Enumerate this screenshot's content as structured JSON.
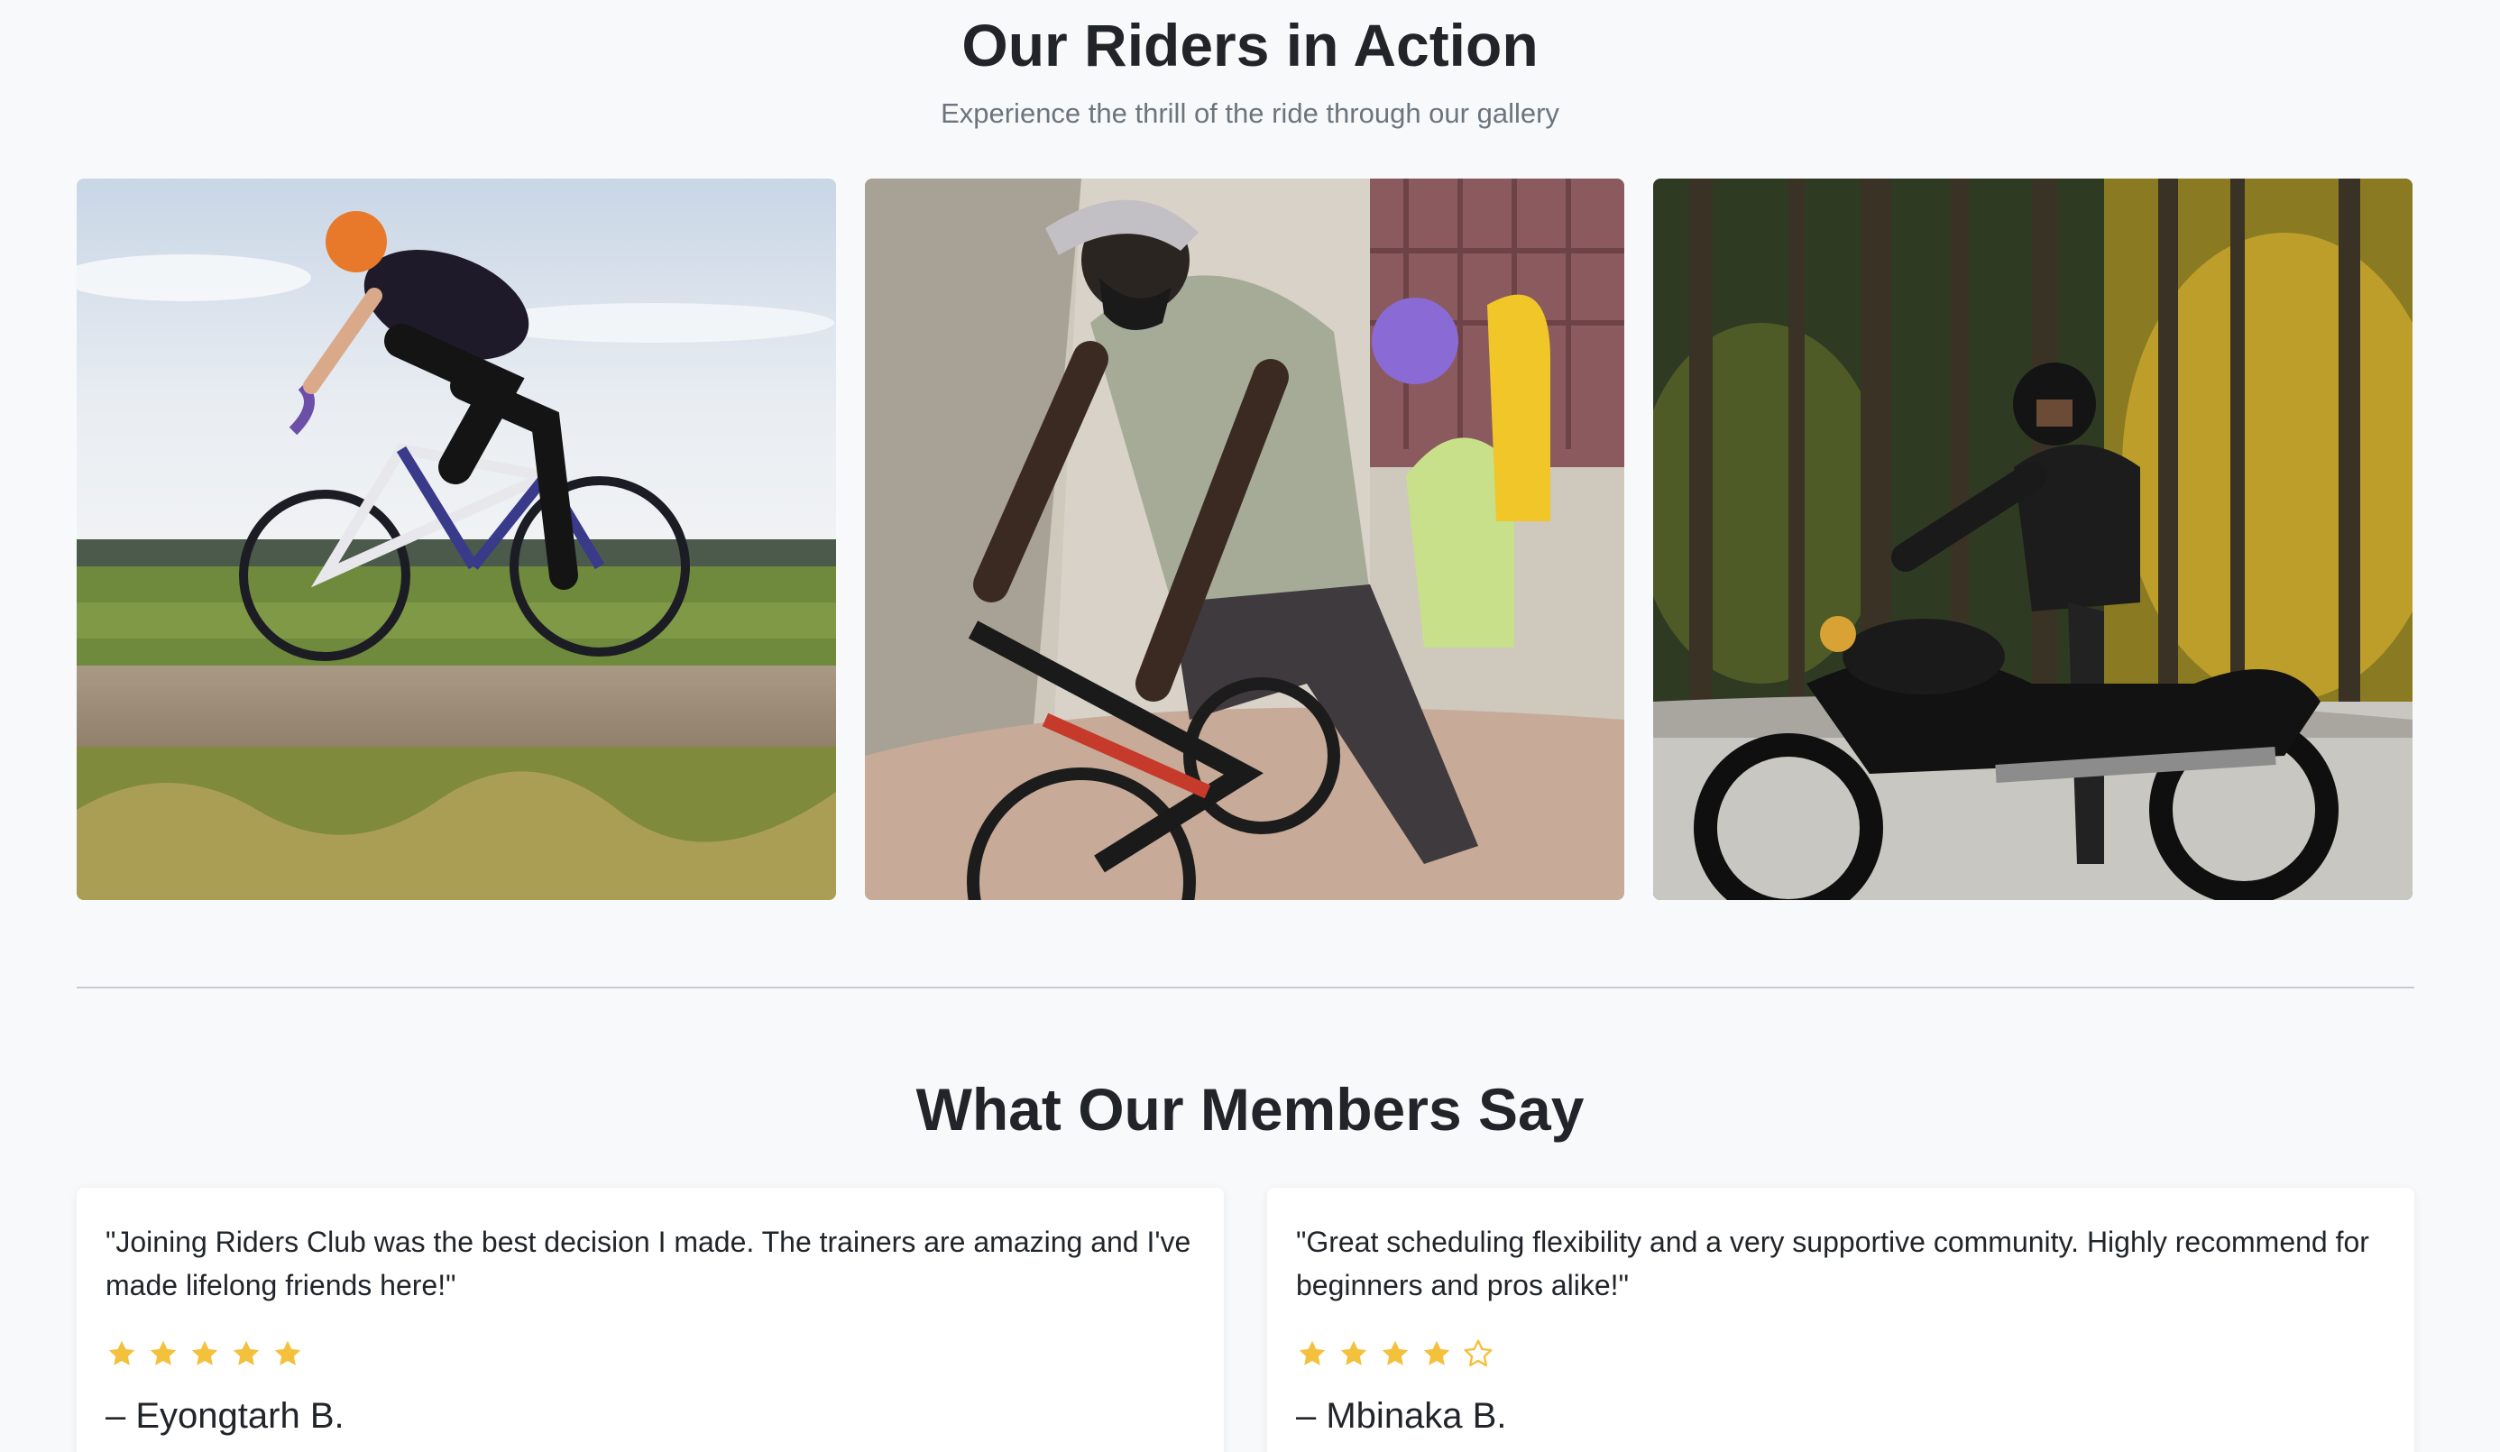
{
  "gallery": {
    "title": "Our Riders in Action",
    "subtitle": "Experience the thrill of the ride through our gallery",
    "photos": [
      {
        "subject": "road cyclist in orange helmet riding a white and purple road bike past fields"
      },
      {
        "subject": "adult in grey t-shirt and face mask on a bike with a child in a purple helmet in a yellow rear seat"
      },
      {
        "subject": "rider in black helmet and leather jacket on a black motorcycle in an autumn forest"
      }
    ]
  },
  "testimonials": {
    "title": "What Our Members Say",
    "items": [
      {
        "quote": "\"Joining Riders Club was the best decision I made. The trainers are amazing and I've made lifelong friends here!\"",
        "rating": 5,
        "max_rating": 5,
        "author": "– Eyongtarh B."
      },
      {
        "quote": "\"Great scheduling flexibility and a very supportive community. Highly recommend for beginners and pros alike!\"",
        "rating": 4,
        "max_rating": 5,
        "author": "– Mbinaka B."
      }
    ]
  },
  "colors": {
    "background": "#f8f9fb",
    "heading": "#212529",
    "subtitle": "#6c757d",
    "star": "#f4c13d",
    "divider": "#c8ccd1"
  },
  "icons": {
    "star_filled": "star-filled-icon",
    "star_empty": "star-outline-icon"
  }
}
